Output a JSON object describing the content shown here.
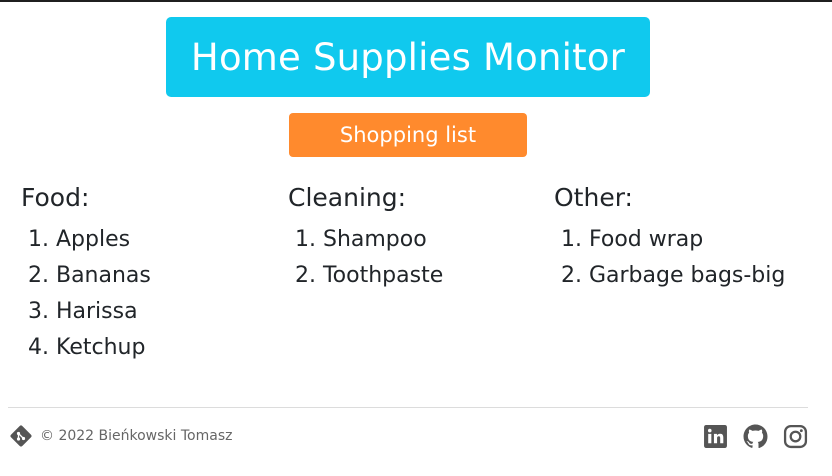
{
  "header": {
    "title": "Home Supplies Monitor",
    "title_bg": "#10c9ee",
    "shopping_button_label": "Shopping list",
    "shopping_button_bg": "#ff8a2d"
  },
  "categories": [
    {
      "title": "Food:",
      "items": [
        "Apples",
        "Bananas",
        "Harissa",
        "Ketchup"
      ]
    },
    {
      "title": "Cleaning:",
      "items": [
        "Shampoo",
        "Toothpaste"
      ]
    },
    {
      "title": "Other:",
      "items": [
        "Food wrap",
        "Garbage bags-big"
      ]
    }
  ],
  "footer": {
    "copyright": "© 2022 Bieńkowski Tomasz",
    "left_icon": "git-icon",
    "social_icons": [
      "linkedin-icon",
      "github-icon",
      "instagram-icon"
    ]
  }
}
